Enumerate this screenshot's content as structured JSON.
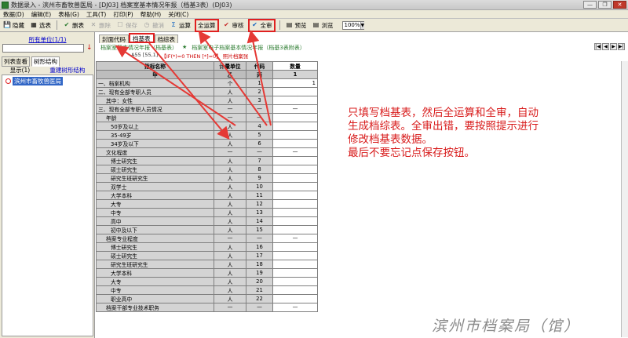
{
  "window": {
    "title": "数据录入 - 滨州市畜牧兽医局 - [DJ03] 档案室基本情况年报（档基3表）(DJ03)",
    "buttons": [
      "—",
      "❐",
      "✕"
    ]
  },
  "menu": [
    "数据(D)",
    "编辑(E)",
    "表格(G)",
    "工具(T)",
    "打印(P)",
    "帮助(H)",
    "关闭(C)"
  ],
  "toolbar": {
    "items": [
      {
        "icon": "💾",
        "label": "隐藏"
      },
      {
        "icon": "▦",
        "label": "选表"
      },
      {
        "icon": "✔",
        "label": "删表"
      },
      {
        "icon": "✕",
        "label": "删除"
      },
      {
        "icon": "☐",
        "label": "保存"
      },
      {
        "icon": "◷",
        "label": "撤消"
      },
      {
        "icon": "Σ",
        "label": "运算"
      },
      {
        "icon": "",
        "label": "全运算"
      },
      {
        "icon": "✔",
        "label": "审核"
      },
      {
        "icon": "✔",
        "label": "全审"
      },
      {
        "icon": "▤",
        "label": "预览"
      },
      {
        "icon": "▤",
        "label": "浏览"
      }
    ],
    "zoom": "100%"
  },
  "left_panel": {
    "unit_link": "所有单位(1/1)",
    "tabs": [
      "列表查看",
      "树形结构"
    ],
    "display_count": "显示(1)",
    "rebuild_link": "重建树形结构",
    "tree_item": "滨州市畜牧兽医局"
  },
  "report": {
    "sheet_tabs": [
      "封面代码",
      "档基表",
      "档综表"
    ],
    "sub_tabs": [
      "档案室基本情况年报（档基表）",
      "★",
      "档案室电子档案基本情况年报（档基3表附表）"
    ],
    "nav": [
      "|◀",
      "◀",
      "▶",
      "▶|"
    ],
    "formula_cell": "A55 [55,1]",
    "formula_text": "【IF(*)=0 THEN [*]=0】 照片档案张",
    "header": [
      "指标名称",
      "计量单位",
      "代码",
      "数量"
    ],
    "header2": [
      "甲",
      "乙",
      "丙",
      "1"
    ],
    "rows": [
      {
        "name": "一、档案机构",
        "unit": "个",
        "code": "1",
        "qty": "1",
        "indent": 0
      },
      {
        "name": "二、现有全部专职人员",
        "unit": "人",
        "code": "2",
        "qty": "",
        "indent": 0
      },
      {
        "name": "其中：女性",
        "unit": "人",
        "code": "3",
        "qty": "",
        "indent": 1
      },
      {
        "name": "三、现有全部专职人员情况",
        "unit": "—",
        "code": "—",
        "qty": "—",
        "indent": 0
      },
      {
        "name": "年龄",
        "unit": "—",
        "code": "—",
        "qty": "",
        "indent": 1
      },
      {
        "name": "50岁及以上",
        "unit": "人",
        "code": "4",
        "qty": "",
        "indent": 2
      },
      {
        "name": "35-49岁",
        "unit": "人",
        "code": "5",
        "qty": "",
        "indent": 2
      },
      {
        "name": "34岁及以下",
        "unit": "人",
        "code": "6",
        "qty": "",
        "indent": 2
      },
      {
        "name": "文化程度",
        "unit": "—",
        "code": "—",
        "qty": "—",
        "indent": 1
      },
      {
        "name": "博士研究生",
        "unit": "人",
        "code": "7",
        "qty": "",
        "indent": 2
      },
      {
        "name": "硕士研究生",
        "unit": "人",
        "code": "8",
        "qty": "",
        "indent": 2
      },
      {
        "name": "研究生班研究生",
        "unit": "人",
        "code": "9",
        "qty": "",
        "indent": 2
      },
      {
        "name": "双学士",
        "unit": "人",
        "code": "10",
        "qty": "",
        "indent": 2
      },
      {
        "name": "大学本科",
        "unit": "人",
        "code": "11",
        "qty": "",
        "indent": 2
      },
      {
        "name": "大专",
        "unit": "人",
        "code": "12",
        "qty": "",
        "indent": 2
      },
      {
        "name": "中专",
        "unit": "人",
        "code": "13",
        "qty": "",
        "indent": 2
      },
      {
        "name": "高中",
        "unit": "人",
        "code": "14",
        "qty": "",
        "indent": 2
      },
      {
        "name": "初中及以下",
        "unit": "人",
        "code": "15",
        "qty": "",
        "indent": 2
      },
      {
        "name": "档案专业程度",
        "unit": "—",
        "code": "—",
        "qty": "—",
        "indent": 1
      },
      {
        "name": "博士研究生",
        "unit": "人",
        "code": "16",
        "qty": "",
        "indent": 2
      },
      {
        "name": "硕士研究生",
        "unit": "人",
        "code": "17",
        "qty": "",
        "indent": 2
      },
      {
        "name": "研究生班研究生",
        "unit": "人",
        "code": "18",
        "qty": "",
        "indent": 2
      },
      {
        "name": "大学本科",
        "unit": "人",
        "code": "19",
        "qty": "",
        "indent": 2
      },
      {
        "name": "大专",
        "unit": "人",
        "code": "20",
        "qty": "",
        "indent": 2
      },
      {
        "name": "中专",
        "unit": "人",
        "code": "21",
        "qty": "",
        "indent": 2
      },
      {
        "name": "职业高中",
        "unit": "人",
        "code": "22",
        "qty": "",
        "indent": 2
      },
      {
        "name": "档案干部专业技术职务",
        "unit": "—",
        "code": "—",
        "qty": "—",
        "indent": 1
      }
    ]
  },
  "annotation": {
    "lines": [
      "只填写档基表，然后全运算和全审，自动",
      "生成档综表。全审出错，要按照提示进行",
      "修改档基表数据。",
      "最后不要忘记点保存按钮。"
    ],
    "color": "#d81b1b"
  },
  "watermark": "滨州市档案局（馆）"
}
